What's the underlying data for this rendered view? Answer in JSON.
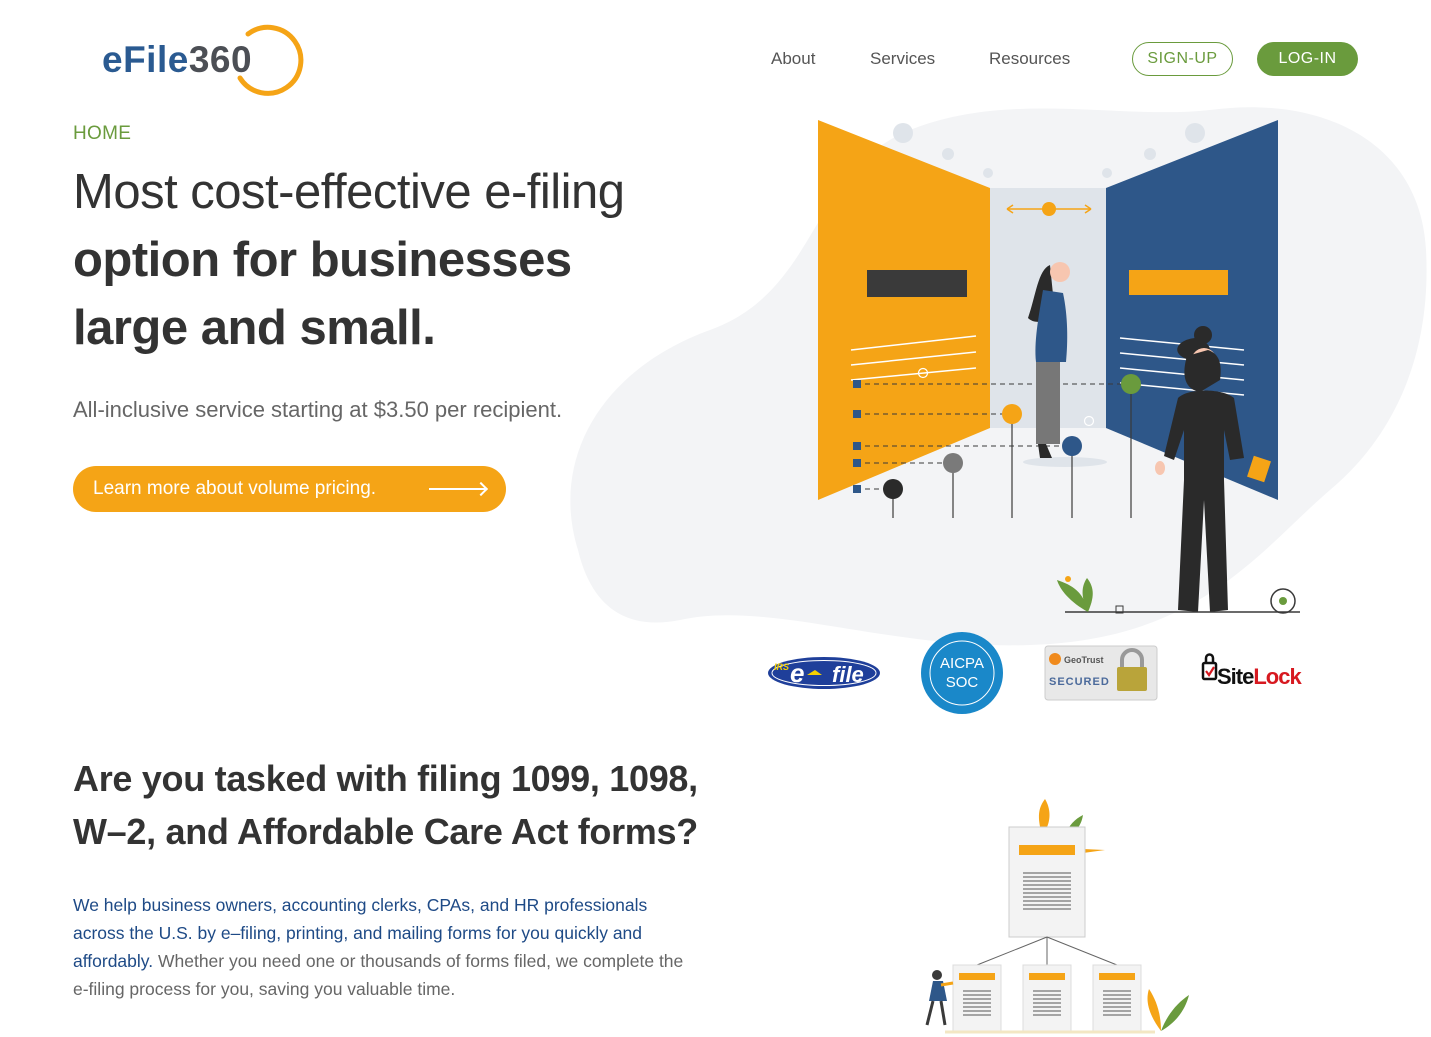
{
  "brand": {
    "logo_text_primary": "eFile",
    "logo_text_secondary": "360",
    "colors": {
      "green": "#6a9b3d",
      "orange": "#f5a416",
      "navy": "#2a5a91",
      "text": "#333333"
    }
  },
  "nav": {
    "links": [
      "About",
      "Services",
      "Resources"
    ],
    "signup_label": "SIGN-UP",
    "login_label": "LOG-IN"
  },
  "hero": {
    "breadcrumb": "HOME",
    "title_line1": "Most cost-effective e-filing",
    "title_line2": "option for businesses",
    "title_line3": "large and small.",
    "subtitle": "All-inclusive service starting at $3.50 per recipient.",
    "cta_label": "Learn more about volume pricing."
  },
  "badges": {
    "irs_prefix": "IRS",
    "irs_e": "e",
    "irs_file": "file",
    "aicpa_line1": "AICPA",
    "aicpa_line2": "SOC",
    "geotrust_brand": "GeoTrust",
    "geotrust_label": "SECURED",
    "sitelock_site": "Site",
    "sitelock_lock": "Lock"
  },
  "section": {
    "title_line1": "Are you tasked with filing 1099, 1098,",
    "title_line2": "W–2, and Affordable Care Act forms?",
    "body_highlight": "We help business owners, accounting clerks, CPAs, and HR professionals across the U.S. by e–filing, printing, and mailing forms for you quickly and affordably.",
    "body_rest": " Whether you need one or thousands of forms filed, we complete the e-filing process for you, saving you valuable time."
  }
}
